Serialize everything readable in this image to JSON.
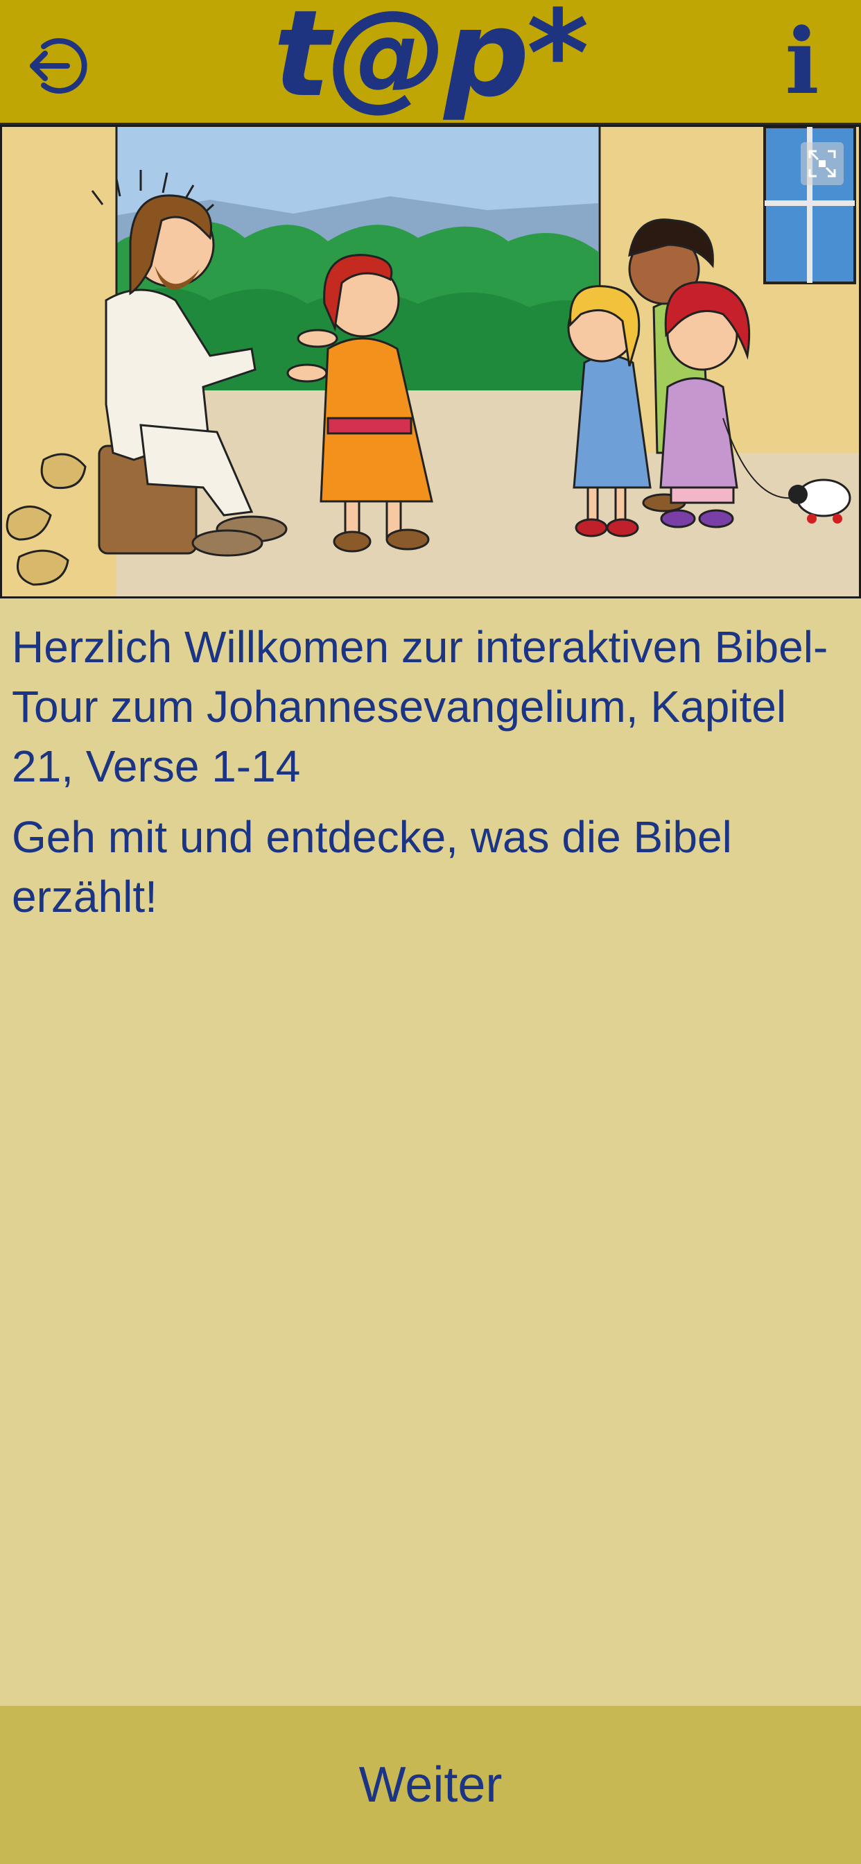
{
  "header": {
    "logo_text": "t@p*",
    "info_label": "i",
    "back_icon": "exit-arrow-icon"
  },
  "colors": {
    "header_bg": "#bfa605",
    "page_bg": "#dfd293",
    "footer_bg": "#c8b853",
    "text": "#1b3584"
  },
  "content": {
    "welcome": "Herzlich Willkomen zur interaktiven Bibel-Tour zum Johannesevangelium, Kapitel 21, Verse 1-14",
    "cta": "Geh mit und entdecke, was die Bibel erzählt!"
  },
  "footer": {
    "next_label": "Weiter"
  }
}
